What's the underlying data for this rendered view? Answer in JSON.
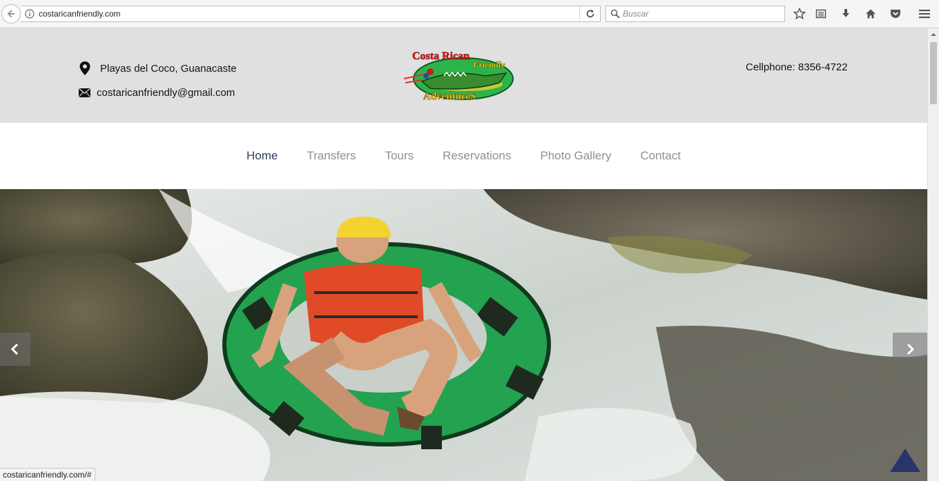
{
  "browser": {
    "url": "costaricanfriendly.com",
    "search_placeholder": "Buscar",
    "status_url": "costaricanfriendly.com/#"
  },
  "header": {
    "location": "Playas del Coco, Guanacaste",
    "email": "costaricanfriendly@gmail.com",
    "cellphone": "Cellphone: 8356-4722",
    "logo_text": [
      "Costa Rican",
      "Friendly",
      "AdventureS"
    ]
  },
  "nav": {
    "items": [
      {
        "label": "Home",
        "active": true
      },
      {
        "label": "Transfers",
        "active": false
      },
      {
        "label": "Tours",
        "active": false
      },
      {
        "label": "Reservations",
        "active": false
      },
      {
        "label": "Photo Gallery",
        "active": false
      },
      {
        "label": "Contact",
        "active": false
      }
    ]
  },
  "colors": {
    "header_bg": "#e0e0e0",
    "nav_active": "#2d3e5c",
    "nav_inactive": "#8f8f8f",
    "to_top": "#27356b"
  }
}
